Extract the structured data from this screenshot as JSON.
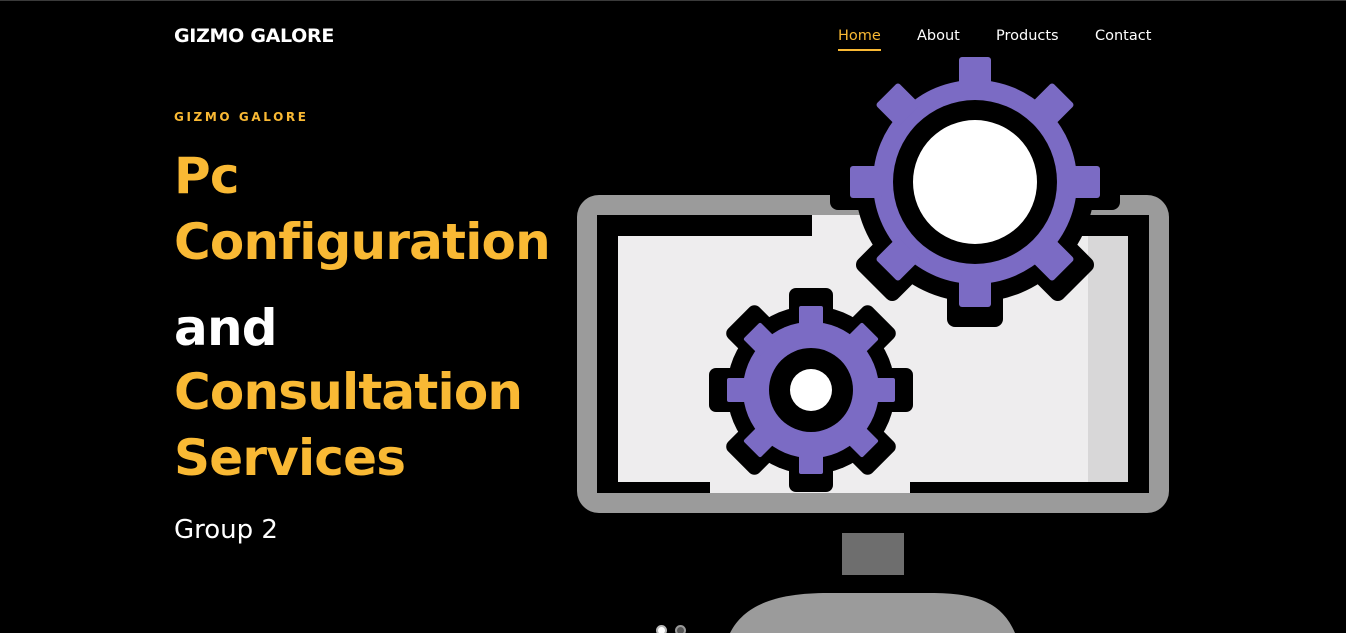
{
  "brand": {
    "name": "GIZMO GALORE"
  },
  "nav": {
    "items": [
      {
        "label": "Home",
        "active": true
      },
      {
        "label": "About",
        "active": false
      },
      {
        "label": "Products",
        "active": false
      },
      {
        "label": "Contact",
        "active": false
      }
    ]
  },
  "hero": {
    "eyebrow": "GIZMO GALORE",
    "lines": [
      "Pc",
      "Configuration",
      "and",
      "Consultation",
      "Services"
    ],
    "subtitle": "Group 2",
    "illustration_icon": "monitor-gears-icon"
  },
  "carousel": {
    "slides": 2,
    "active_index": 0
  },
  "colors": {
    "background": "#000000",
    "accent": "#f9b934",
    "text": "#ffffff",
    "gear": "#7b6bc4",
    "monitor_frame": "#9b9b9b",
    "screen": "#eeedee"
  }
}
